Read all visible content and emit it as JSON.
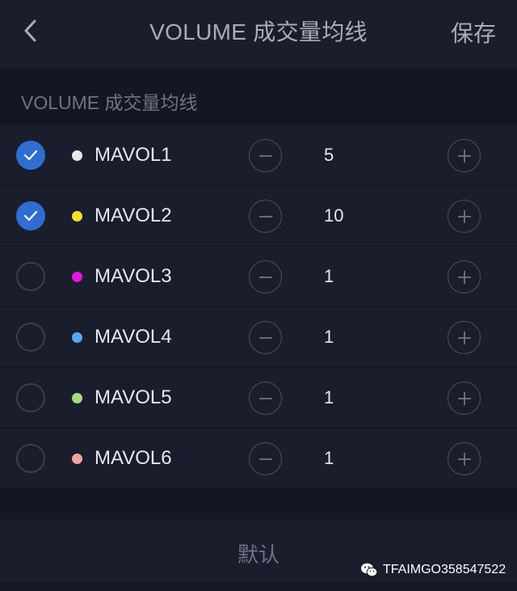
{
  "navbar": {
    "back_icon": "chevron-left-icon",
    "title": "VOLUME 成交量均线",
    "save_label": "保存"
  },
  "section": {
    "title": "VOLUME 成交量均线"
  },
  "rows": [
    {
      "name": "MAVOL1",
      "value": "5",
      "checked": true,
      "color": "#e8e8e8"
    },
    {
      "name": "MAVOL2",
      "value": "10",
      "checked": true,
      "color": "#f2e12a"
    },
    {
      "name": "MAVOL3",
      "value": "1",
      "checked": false,
      "color": "#e01bd8"
    },
    {
      "name": "MAVOL4",
      "value": "1",
      "checked": false,
      "color": "#5aa9ee"
    },
    {
      "name": "MAVOL5",
      "value": "1",
      "checked": false,
      "color": "#a8da83"
    },
    {
      "name": "MAVOL6",
      "value": "1",
      "checked": false,
      "color": "#f1a4a0"
    }
  ],
  "footer": {
    "default_label": "默认"
  },
  "watermark": {
    "icon": "wechat-icon",
    "text": "TFAIMGO358547522"
  },
  "colors": {
    "background": "#141824",
    "panel": "#1a1e2c",
    "accent": "#2f6ed0",
    "muted_text": "#6e7486"
  }
}
